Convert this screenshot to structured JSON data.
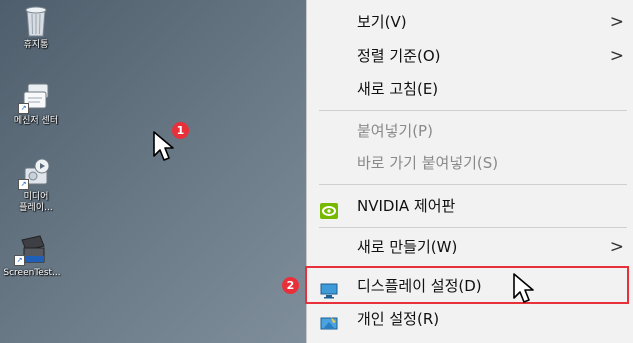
{
  "desktop": {
    "icons": [
      {
        "label": "휴지통"
      },
      {
        "label": "메신저 센터"
      },
      {
        "label": "미디어\n플레이..."
      },
      {
        "label": "ScreenTest..."
      }
    ],
    "step_badges": [
      "1",
      "2"
    ]
  },
  "context_menu": {
    "items": [
      {
        "label": "보기(V)",
        "arrow": ">"
      },
      {
        "label": "정렬 기준(O)",
        "arrow": ">"
      },
      {
        "label": "새로 고침(E)"
      },
      {
        "label": "붙여넣기(P)"
      },
      {
        "label": "바로 가기 붙여넣기(S)"
      },
      {
        "label": "NVIDIA 제어판"
      },
      {
        "label": "새로 만들기(W)",
        "arrow": ">"
      },
      {
        "label": "디스플레이 설정(D)"
      },
      {
        "label": "개인 설정(R)"
      }
    ]
  },
  "colors": {
    "highlight": "#e8303b",
    "nvidia": "#76b900"
  }
}
